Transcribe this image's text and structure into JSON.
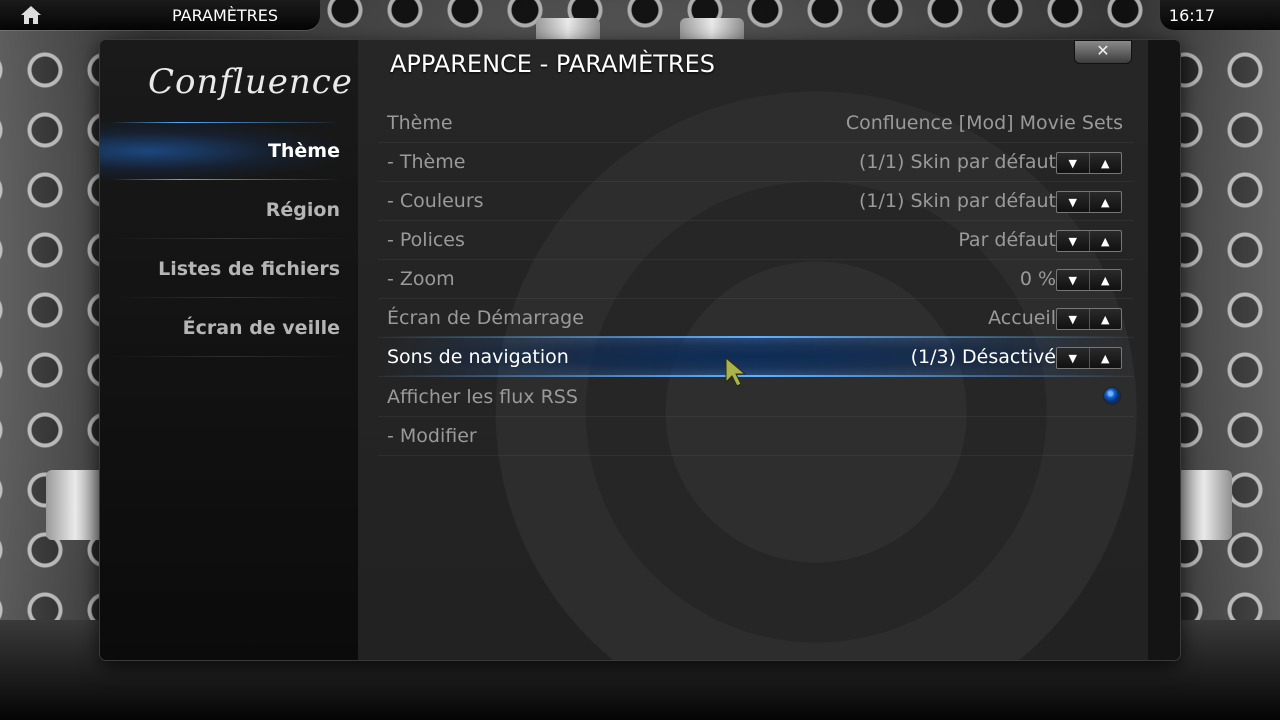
{
  "topbar": {
    "title": "PARAMÈTRES",
    "clock": "16:17"
  },
  "sidebar": {
    "logo": "Confluence",
    "items": [
      {
        "label": "Thème",
        "active": true
      },
      {
        "label": "Région",
        "active": false
      },
      {
        "label": "Listes de fichiers",
        "active": false
      },
      {
        "label": "Écran de veille",
        "active": false
      }
    ]
  },
  "dialog": {
    "title": "APPARENCE - PARAMÈTRES",
    "close_label": "✕"
  },
  "settings": [
    {
      "label": "Thème",
      "value": "Confluence [Mod] Movie Sets",
      "control": "none"
    },
    {
      "label": "- Thème",
      "value": "(1/1) Skin par défaut",
      "control": "spinner"
    },
    {
      "label": "- Couleurs",
      "value": "(1/1) Skin par défaut",
      "control": "spinner"
    },
    {
      "label": "- Polices",
      "value": "Par défaut",
      "control": "spinner"
    },
    {
      "label": "- Zoom",
      "value": "0 %",
      "control": "spinner"
    },
    {
      "label": "Écran de Démarrage",
      "value": "Accueil",
      "control": "spinner"
    },
    {
      "label": "Sons de navigation",
      "value": "(1/3) Désactivé",
      "control": "spinner",
      "focused": true
    },
    {
      "label": "Afficher les flux RSS",
      "value": "",
      "control": "radio",
      "checked": true
    },
    {
      "label": "- Modifier",
      "value": "",
      "control": "none"
    }
  ],
  "spinner": {
    "down": "▼",
    "up": "▲"
  },
  "colors": {
    "focus_blue": "#1e6edc",
    "radio_blue": "#1463d4"
  }
}
